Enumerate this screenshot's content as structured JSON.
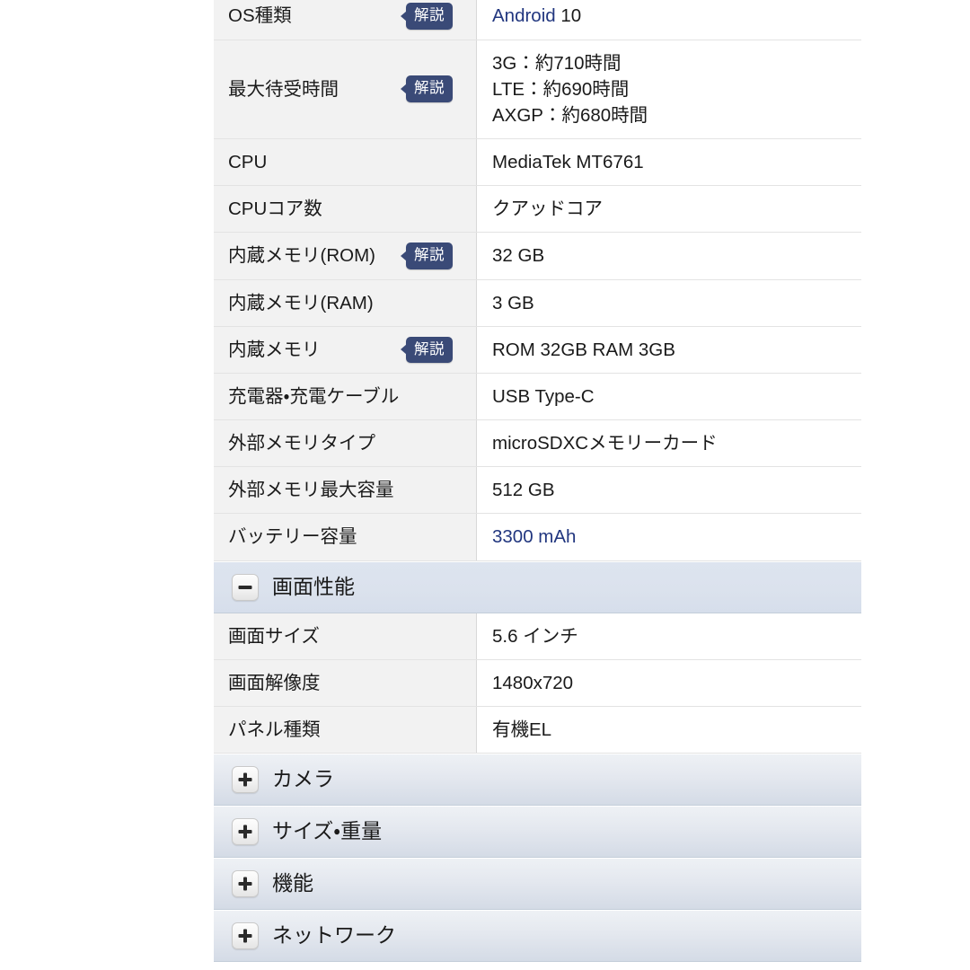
{
  "table": {
    "rows": [
      {
        "kind": "spec",
        "label": "OS種類",
        "badge": "解説",
        "value_html": [
          {
            "text": "Android",
            "link": true
          },
          {
            "text": " 10",
            "link": false
          }
        ]
      },
      {
        "kind": "spec",
        "label": "最大待受時間",
        "badge": "解説",
        "value_lines": [
          "3G：約710時間",
          "LTE：約690時間",
          "AXGP：約680時間"
        ]
      },
      {
        "kind": "spec",
        "label": "CPU",
        "badge": null,
        "value": "MediaTek MT6761"
      },
      {
        "kind": "spec",
        "label": "CPUコア数",
        "badge": null,
        "value": "クアッドコア"
      },
      {
        "kind": "spec",
        "label": "内蔵メモリ(ROM)",
        "badge": "解説",
        "value": "32 GB"
      },
      {
        "kind": "spec",
        "label": "内蔵メモリ(RAM)",
        "badge": null,
        "value": "3 GB"
      },
      {
        "kind": "spec",
        "label": "内蔵メモリ",
        "badge": "解説",
        "value": "ROM 32GB RAM 3GB"
      },
      {
        "kind": "spec",
        "label": "充電器・充電ケーブル",
        "badge": null,
        "value": "USB Type-C"
      },
      {
        "kind": "spec",
        "label": "外部メモリタイプ",
        "badge": null,
        "value": "microSDXCメモリーカード"
      },
      {
        "kind": "spec",
        "label": "外部メモリ最大容量",
        "badge": null,
        "value": "512 GB"
      },
      {
        "kind": "spec",
        "label": "バッテリー容量",
        "badge": null,
        "value_html": [
          {
            "text": "3300 mAh",
            "link": true
          }
        ]
      },
      {
        "kind": "section",
        "title": "画面性能",
        "state": "expanded",
        "toggle_icon": "minus-icon"
      },
      {
        "kind": "spec",
        "label": "画面サイズ",
        "badge": null,
        "value": "5.6 インチ"
      },
      {
        "kind": "spec",
        "label": "画面解像度",
        "badge": null,
        "value": "1480x720"
      },
      {
        "kind": "spec",
        "label": "パネル種類",
        "badge": null,
        "value": "有機EL"
      },
      {
        "kind": "section",
        "title": "カメラ",
        "state": "collapsed",
        "toggle_icon": "plus-icon"
      },
      {
        "kind": "section",
        "title": "サイズ・重量",
        "state": "collapsed",
        "toggle_icon": "plus-icon"
      },
      {
        "kind": "section",
        "title": "機能",
        "state": "collapsed",
        "toggle_icon": "plus-icon"
      },
      {
        "kind": "section",
        "title": "ネットワーク",
        "state": "collapsed",
        "toggle_icon": "plus-icon"
      }
    ]
  },
  "colors": {
    "badge_bg": "#3a4a77",
    "link_text": "#21367f",
    "label_bg": "#f2f2f2",
    "value_bg": "#ffffff",
    "section_expanded_bg": "#dbe2ed",
    "section_collapsed_bg": "#e4e8ef",
    "row_border": "#e3e3e3"
  }
}
